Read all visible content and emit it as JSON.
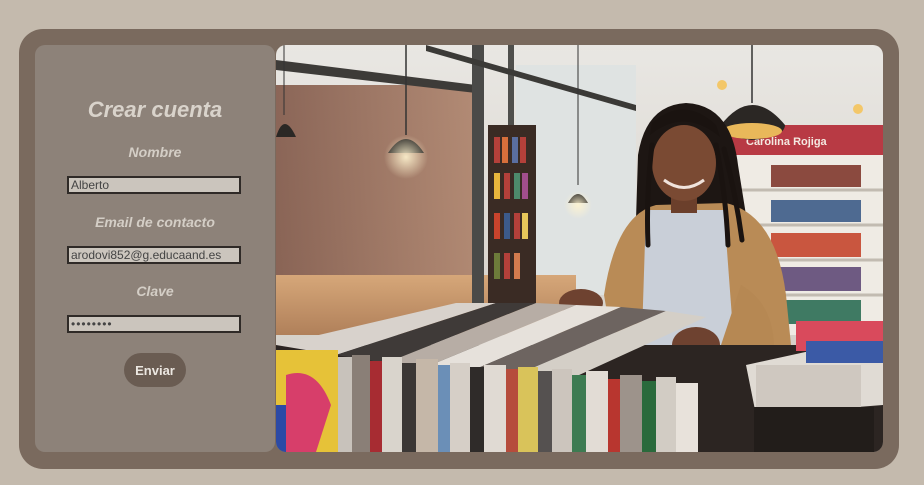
{
  "form": {
    "title": "Crear cuenta",
    "name_label": "Nombre",
    "name_value": "Alberto",
    "email_label": "Email de contacto",
    "email_value": "arodovi852@g.educaand.es",
    "password_label": "Clave",
    "password_value": "••••••••",
    "submit_label": "Enviar"
  },
  "photo": {
    "shop_sign": "Carolina Rojiga"
  },
  "colors": {
    "page_bg": "#c4baad",
    "frame": "#7a6a5e",
    "panel": "#8d8279",
    "button": "#6a5c52"
  }
}
